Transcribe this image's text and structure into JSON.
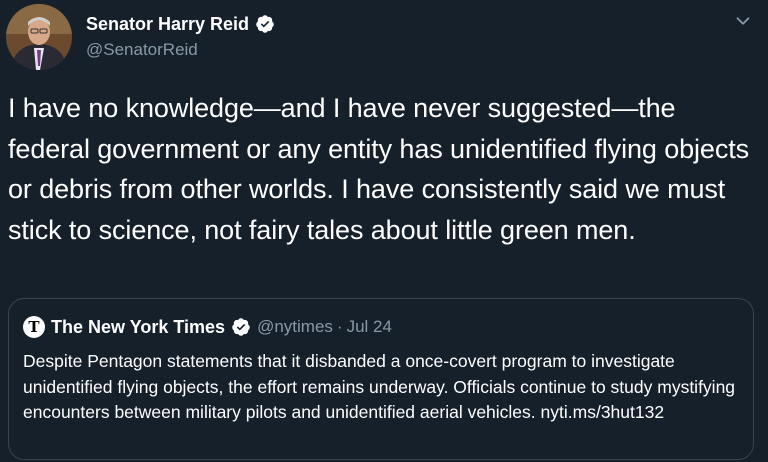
{
  "author": {
    "name": "Senator Harry Reid",
    "handle": "@SenatorReid"
  },
  "icons": {
    "verified": "verified-badge-icon",
    "more": "chevron-down-icon"
  },
  "colors": {
    "background": "#15202b",
    "secondary_text": "#8899a6",
    "border": "#38444d"
  },
  "tweet": {
    "text": "I have no knowledge—and I have never suggested—the federal government or any entity has unidentified flying objects or debris from other worlds. I have consistently said we must stick to science, not fairy tales about little green men."
  },
  "quoted_tweet": {
    "avatar_letter": "T",
    "name": "The New York Times",
    "handle": "@nytimes",
    "separator": "·",
    "date": "Jul 24",
    "text": "Despite Pentagon statements that it disbanded a once-covert program to investigate unidentified flying objects, the effort remains underway. Officials continue to study mystifying encounters between military pilots and unidentified aerial vehicles.",
    "link": "nyti.ms/3hut132"
  }
}
